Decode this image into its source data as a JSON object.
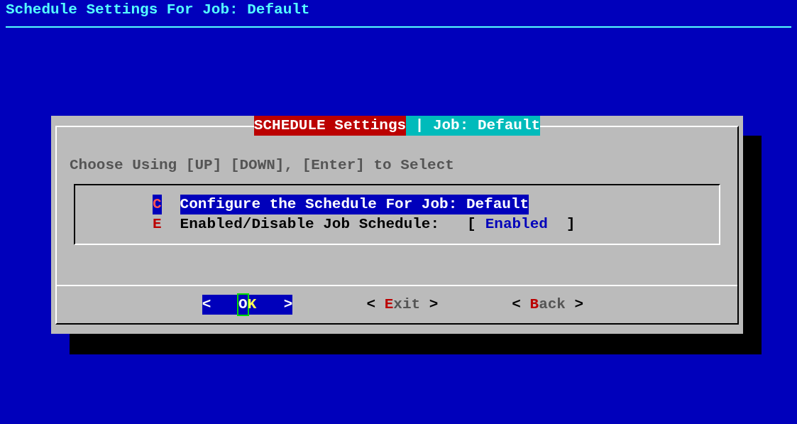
{
  "screen": {
    "title": "Schedule Settings For Job: Default"
  },
  "dialog": {
    "title_main": "SCHEDULE Settings",
    "title_sub": "| Job: Default",
    "prompt": "Choose Using [UP] [DOWN], [Enter] to Select",
    "menu": [
      {
        "tag": "C",
        "label": "Configure the Schedule For Job: Default",
        "selected": true
      },
      {
        "tag": "E",
        "label": "Enabled/Disable Job Schedule:",
        "selected": false,
        "value_open": "[",
        "value": "Enabled",
        "value_close": "]"
      }
    ],
    "buttons": [
      {
        "left": "<",
        "hotkey": "O",
        "rest": "K",
        "right": ">",
        "selected": true
      },
      {
        "left": "<",
        "hotkey": "E",
        "rest": "xit",
        "right": ">",
        "selected": false
      },
      {
        "left": "<",
        "hotkey": "B",
        "rest": "ack",
        "right": ">",
        "selected": false
      }
    ]
  }
}
